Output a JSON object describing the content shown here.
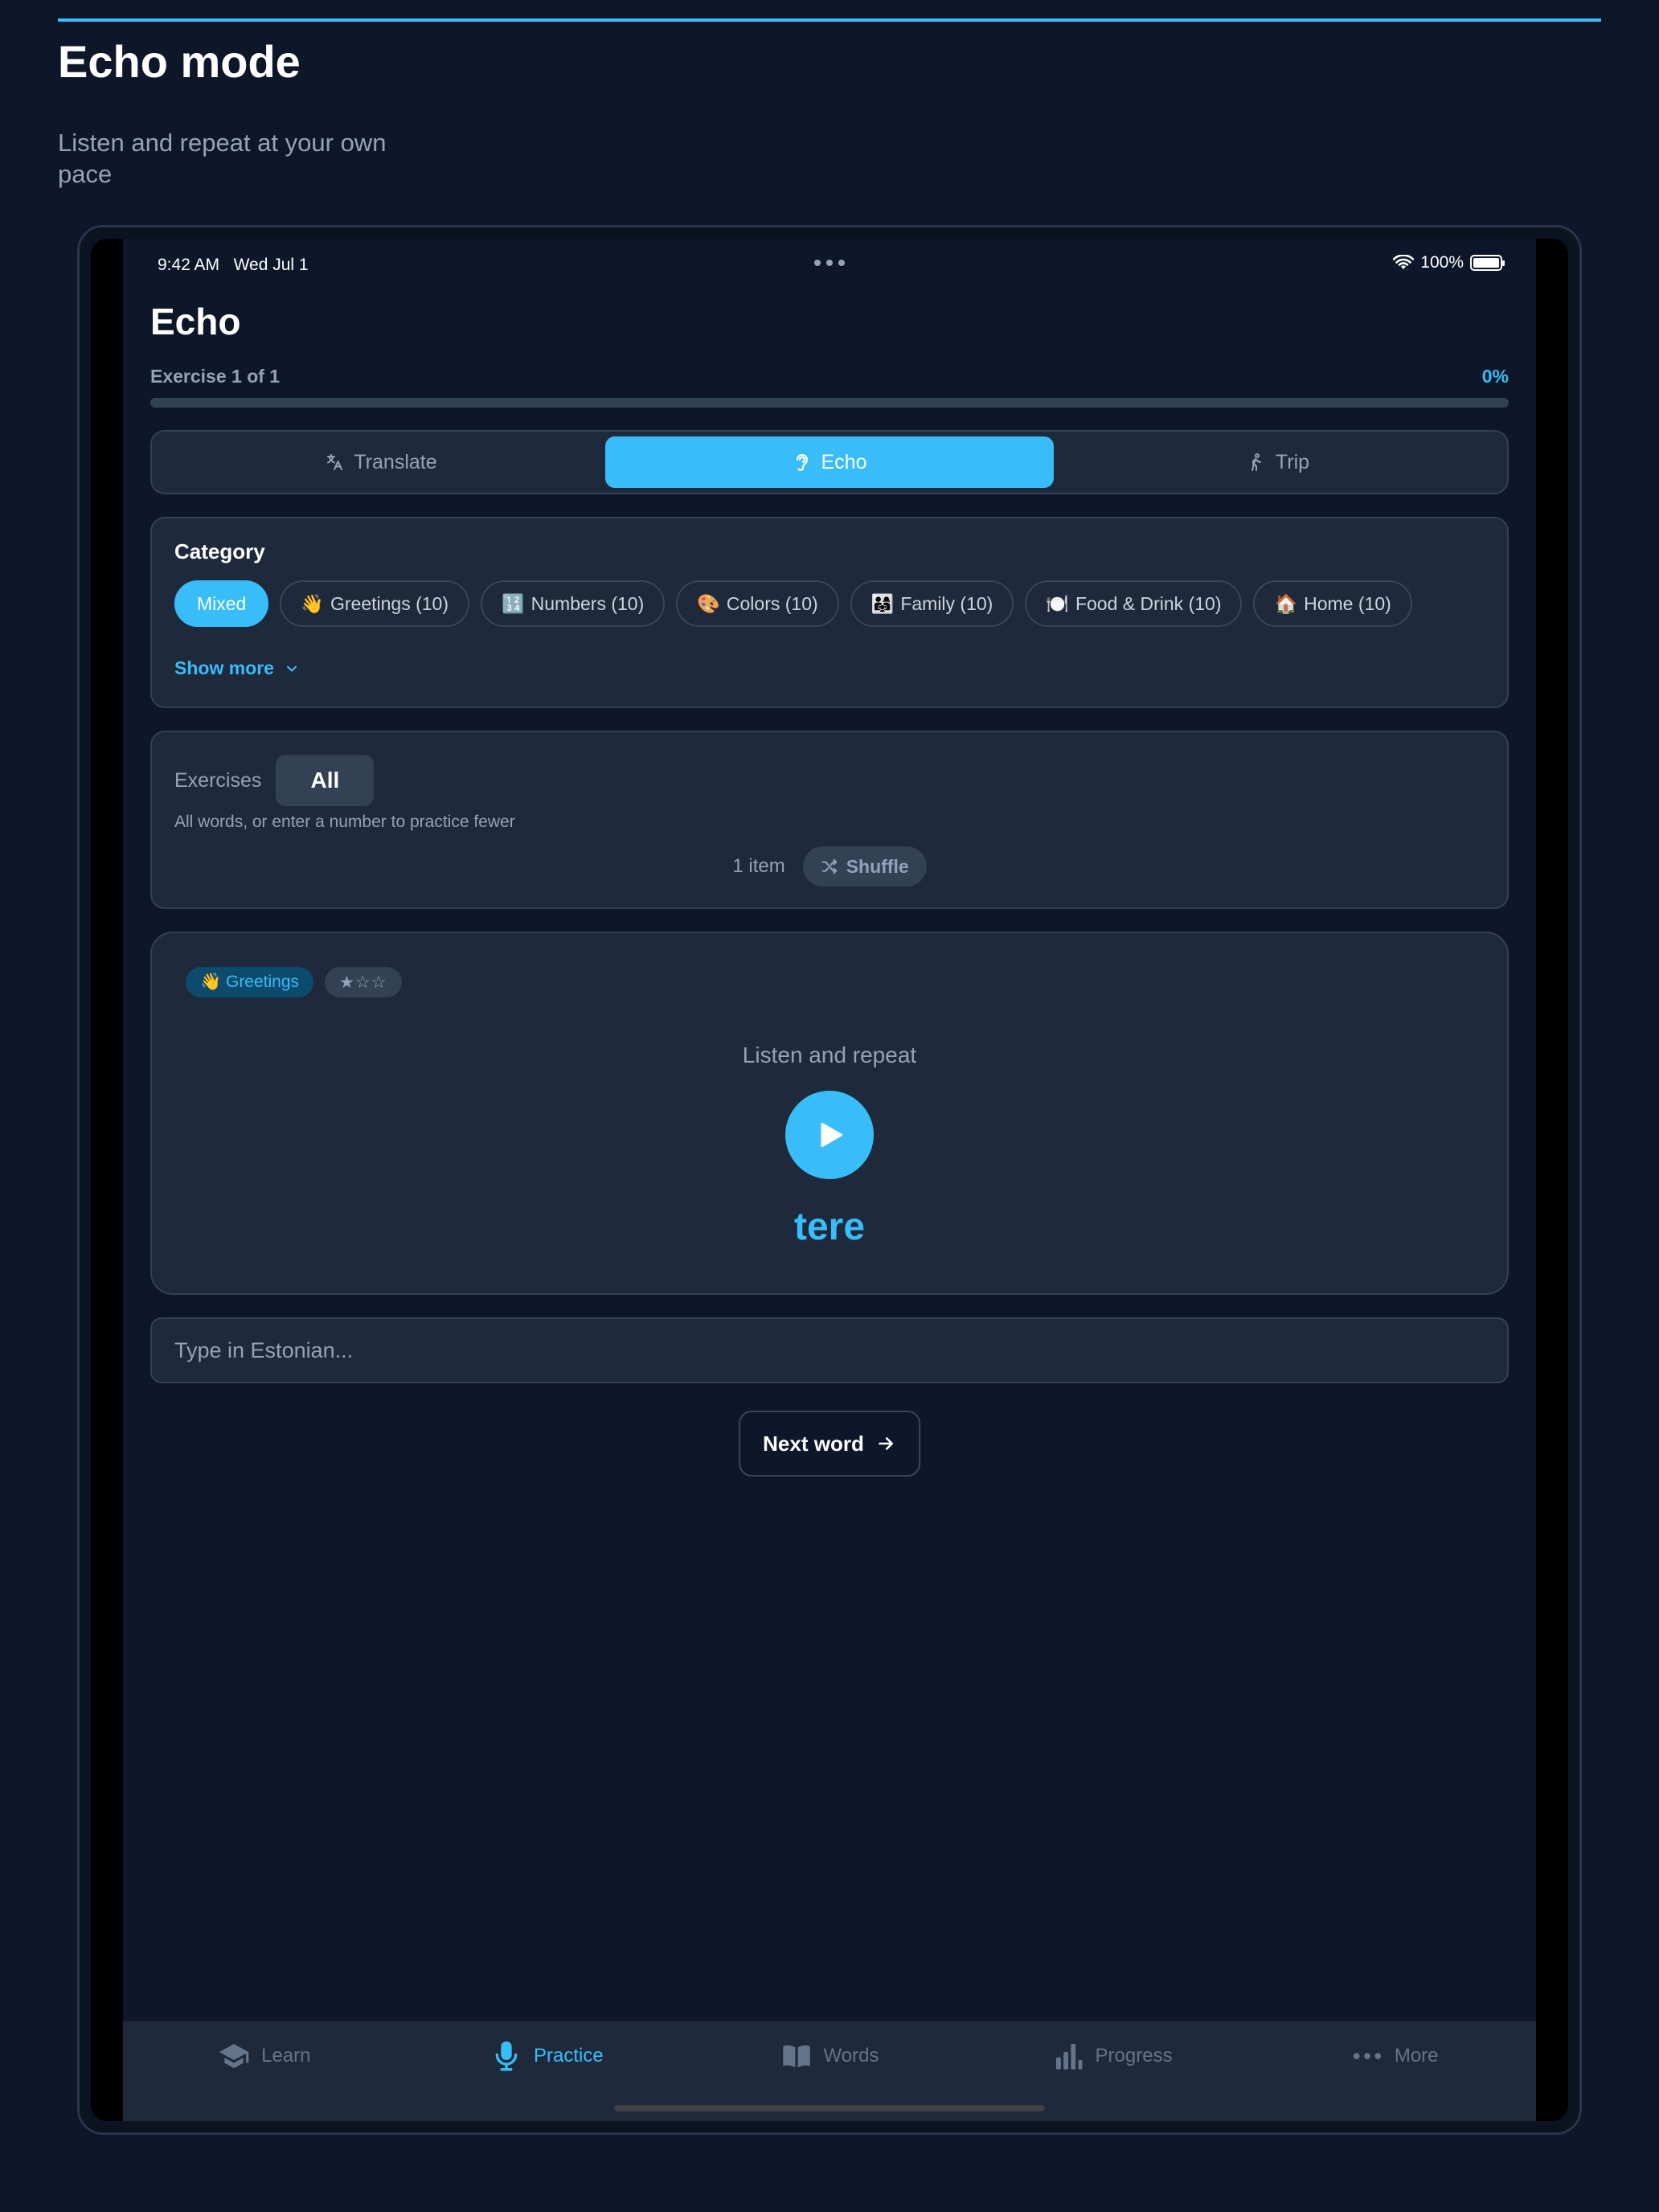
{
  "page": {
    "title": "Echo mode",
    "subtitle": "Listen and repeat at your own pace"
  },
  "status_bar": {
    "time": "9:42 AM",
    "date": "Wed Jul 1",
    "battery": "100%"
  },
  "app": {
    "title": "Echo",
    "exercise_label": "Exercise 1 of 1",
    "progress_text": "0%",
    "progress_value": 0
  },
  "modes": [
    {
      "label": "Translate",
      "icon": "translate-icon",
      "active": false
    },
    {
      "label": "Echo",
      "icon": "ear-icon",
      "active": true
    },
    {
      "label": "Trip",
      "icon": "walking-icon",
      "active": false
    }
  ],
  "category": {
    "heading": "Category",
    "chips": [
      {
        "emoji": "",
        "label": "Mixed",
        "active": true
      },
      {
        "emoji": "👋",
        "label": "Greetings (10)",
        "active": false
      },
      {
        "emoji": "🔢",
        "label": "Numbers (10)",
        "active": false
      },
      {
        "emoji": "🎨",
        "label": "Colors (10)",
        "active": false
      },
      {
        "emoji": "👨‍👩‍👧",
        "label": "Family (10)",
        "active": false
      },
      {
        "emoji": "🍽️",
        "label": "Food & Drink (10)",
        "active": false
      },
      {
        "emoji": "🏠",
        "label": "Home (10)",
        "active": false
      }
    ],
    "show_more": "Show more"
  },
  "exercises": {
    "label": "Exercises",
    "value": "All",
    "hint": "All words, or enter a number to practice fewer",
    "count": "1 item",
    "shuffle": "Shuffle"
  },
  "practice": {
    "category_tag": "👋 Greetings",
    "difficulty": "★☆☆",
    "instruction": "Listen and repeat",
    "word": "tere"
  },
  "answer": {
    "placeholder": "Type in Estonian..."
  },
  "next_button": "Next word",
  "tabbar": [
    {
      "label": "Learn",
      "icon": "graduation-cap-icon",
      "active": false
    },
    {
      "label": "Practice",
      "icon": "microphone-icon",
      "active": true
    },
    {
      "label": "Words",
      "icon": "book-icon",
      "active": false
    },
    {
      "label": "Progress",
      "icon": "bar-chart-icon",
      "active": false
    },
    {
      "label": "More",
      "icon": "more-dots-icon",
      "active": false
    }
  ],
  "colors": {
    "accent": "#38bdf8",
    "background": "#0e172a",
    "card": "#1e293b",
    "border": "#334155",
    "muted": "#94a3b8"
  }
}
